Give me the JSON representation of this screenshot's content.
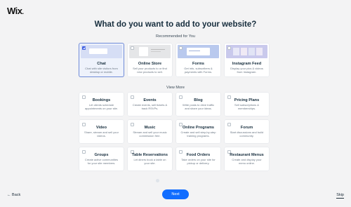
{
  "logo": "Wix",
  "title": "What do you want to add to your website?",
  "recommended_label": "Recommended for You",
  "view_more_label": "View More",
  "recommended": [
    {
      "title": "Chat",
      "desc": "Chat with site visitors from desktop or mobile.",
      "checked": true
    },
    {
      "title": "Online Store",
      "desc": "Sell your products to or find new products to sell.",
      "checked": false
    },
    {
      "title": "Forms",
      "desc": "Get info, subscribers & payments with Forms.",
      "checked": false
    },
    {
      "title": "Instagram Feed",
      "desc": "Display your pics & videos from Instagram.",
      "checked": false
    }
  ],
  "more": [
    {
      "title": "Bookings",
      "desc": "Let clients schedule appointments on your site."
    },
    {
      "title": "Events",
      "desc": "Create events, sell tickets & track RSVPs."
    },
    {
      "title": "Blog",
      "desc": "Write posts to drive traffic and share your ideas."
    },
    {
      "title": "Pricing Plans",
      "desc": "Sell subscriptions & memberships."
    },
    {
      "title": "Video",
      "desc": "Share, stream and sell your videos."
    },
    {
      "title": "Music",
      "desc": "Stream and sell your music commission free."
    },
    {
      "title": "Online Programs",
      "desc": "Create and sell step-by-step training programs."
    },
    {
      "title": "Forum",
      "desc": "Start discussions and build community."
    },
    {
      "title": "Groups",
      "desc": "Create active communities for your site members."
    },
    {
      "title": "Table Reservations",
      "desc": "Let diners book a table on your site."
    },
    {
      "title": "Food Orders",
      "desc": "Take orders on your site for pickup or delivery."
    },
    {
      "title": "Restaurant Menus",
      "desc": "Create and display your menu online."
    }
  ],
  "footer": {
    "back": "← Back",
    "next": "Next",
    "skip": "Skip"
  },
  "colors": {
    "accent": "#116dff",
    "selected_border": "#6f8bd8",
    "checkbox_checked": "#3b5ce0"
  }
}
